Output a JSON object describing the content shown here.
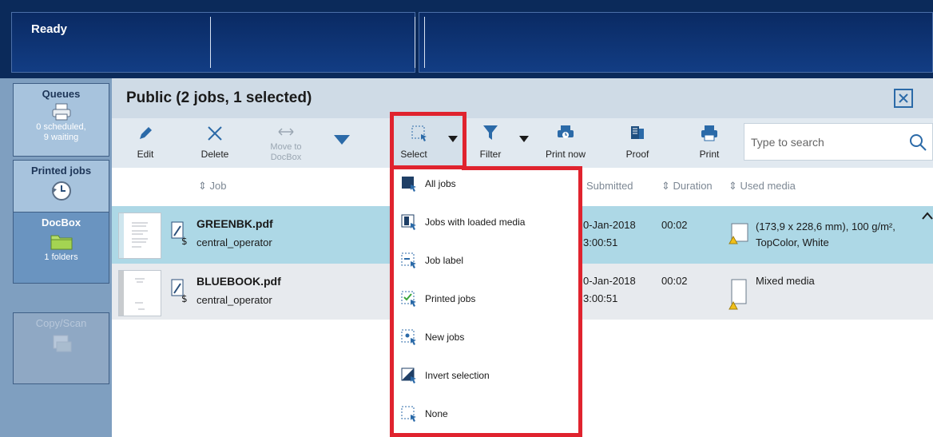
{
  "status": {
    "text": "Ready"
  },
  "nav": {
    "queues": {
      "label": "Queues",
      "sub1": "0 scheduled,",
      "sub2": "9 waiting"
    },
    "printed_jobs": {
      "label": "Printed jobs"
    },
    "docbox": {
      "label": "DocBox",
      "sub": "1 folders"
    },
    "copy_scan": {
      "label": "Copy/Scan"
    }
  },
  "main": {
    "title": "Public (2 jobs, 1 selected)"
  },
  "toolbar": {
    "edit": "Edit",
    "delete": "Delete",
    "move_to_docbox_1": "Move to",
    "move_to_docbox_2": "DocBox",
    "select": "Select",
    "filter": "Filter",
    "print_now": "Print now",
    "proof": "Proof",
    "print": "Print",
    "search_placeholder": "Type to search"
  },
  "columns": {
    "job": "Job",
    "submitted": "Submitted",
    "duration": "Duration",
    "used_media": "Used media"
  },
  "jobs": [
    {
      "name": "GREENBK.pdf",
      "owner": "central_operator",
      "submitted_date": "0-Jan-2018",
      "submitted_time": "3:00:51",
      "duration": "00:02",
      "media_line1": "(173,9 x 228,6 mm), 100 g/m²,",
      "media_line2": "TopColor, White"
    },
    {
      "name": "BLUEBOOK.pdf",
      "owner": "central_operator",
      "submitted_date": "0-Jan-2018",
      "submitted_time": "3:00:51",
      "duration": "00:02",
      "media_line1": "Mixed media",
      "media_line2": ""
    }
  ],
  "select_menu": {
    "items": [
      "All jobs",
      "Jobs with loaded media",
      "Job label",
      "Printed jobs",
      "New jobs",
      "Invert selection",
      "None"
    ]
  },
  "colors": {
    "accent": "#2b6aa8",
    "highlight": "#e0232e",
    "selected_row": "#add8e6"
  }
}
